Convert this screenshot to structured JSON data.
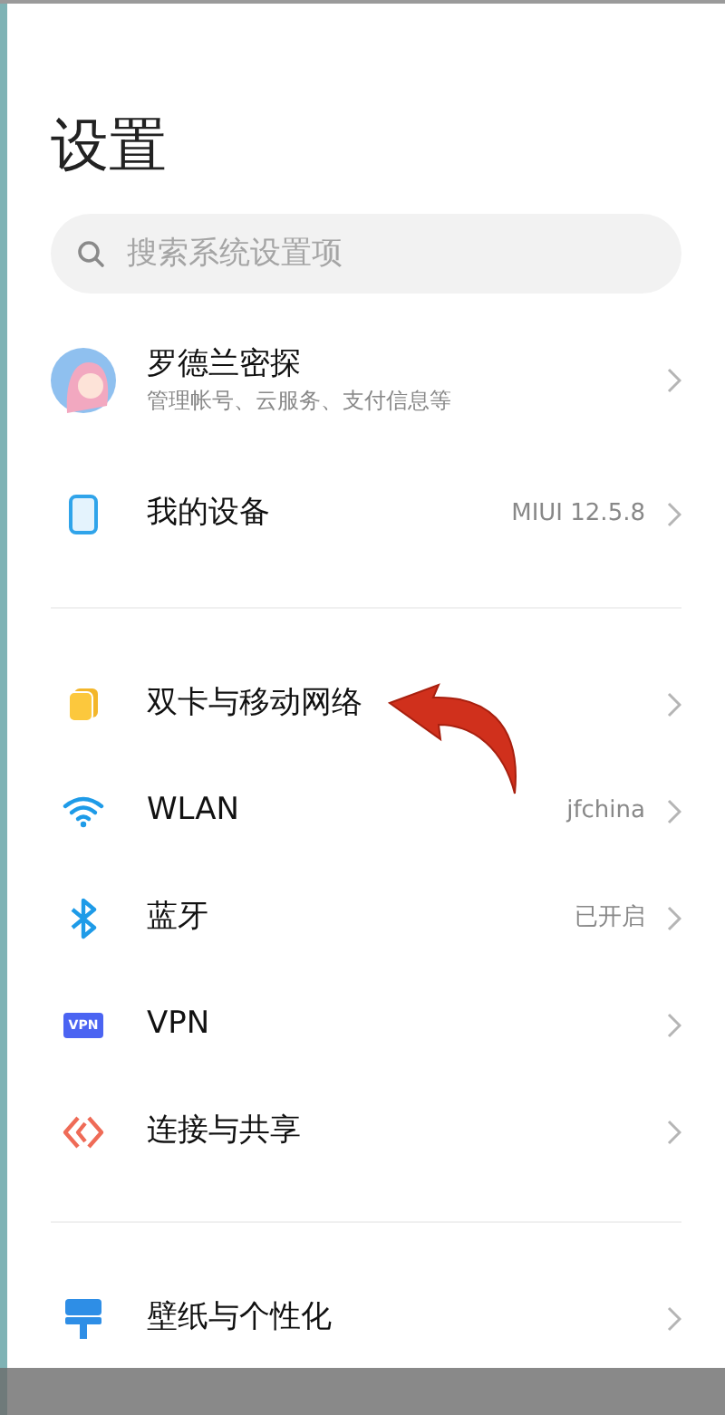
{
  "title": "设置",
  "search": {
    "placeholder": "搜索系统设置项"
  },
  "account": {
    "name": "罗德兰密探",
    "subtitle": "管理帐号、云服务、支付信息等"
  },
  "device": {
    "label": "我的设备",
    "value": "MIUI 12.5.8"
  },
  "groups": [
    [
      {
        "kind": "sim",
        "label": "双卡与移动网络"
      },
      {
        "kind": "wifi",
        "label": "WLAN",
        "value": "jfchina"
      },
      {
        "kind": "bluetooth",
        "label": "蓝牙",
        "value": "已开启"
      },
      {
        "kind": "vpn",
        "label": "VPN",
        "badge": "VPN"
      },
      {
        "kind": "share",
        "label": "连接与共享"
      }
    ],
    [
      {
        "kind": "wallpaper",
        "label": "壁纸与个性化"
      }
    ]
  ]
}
